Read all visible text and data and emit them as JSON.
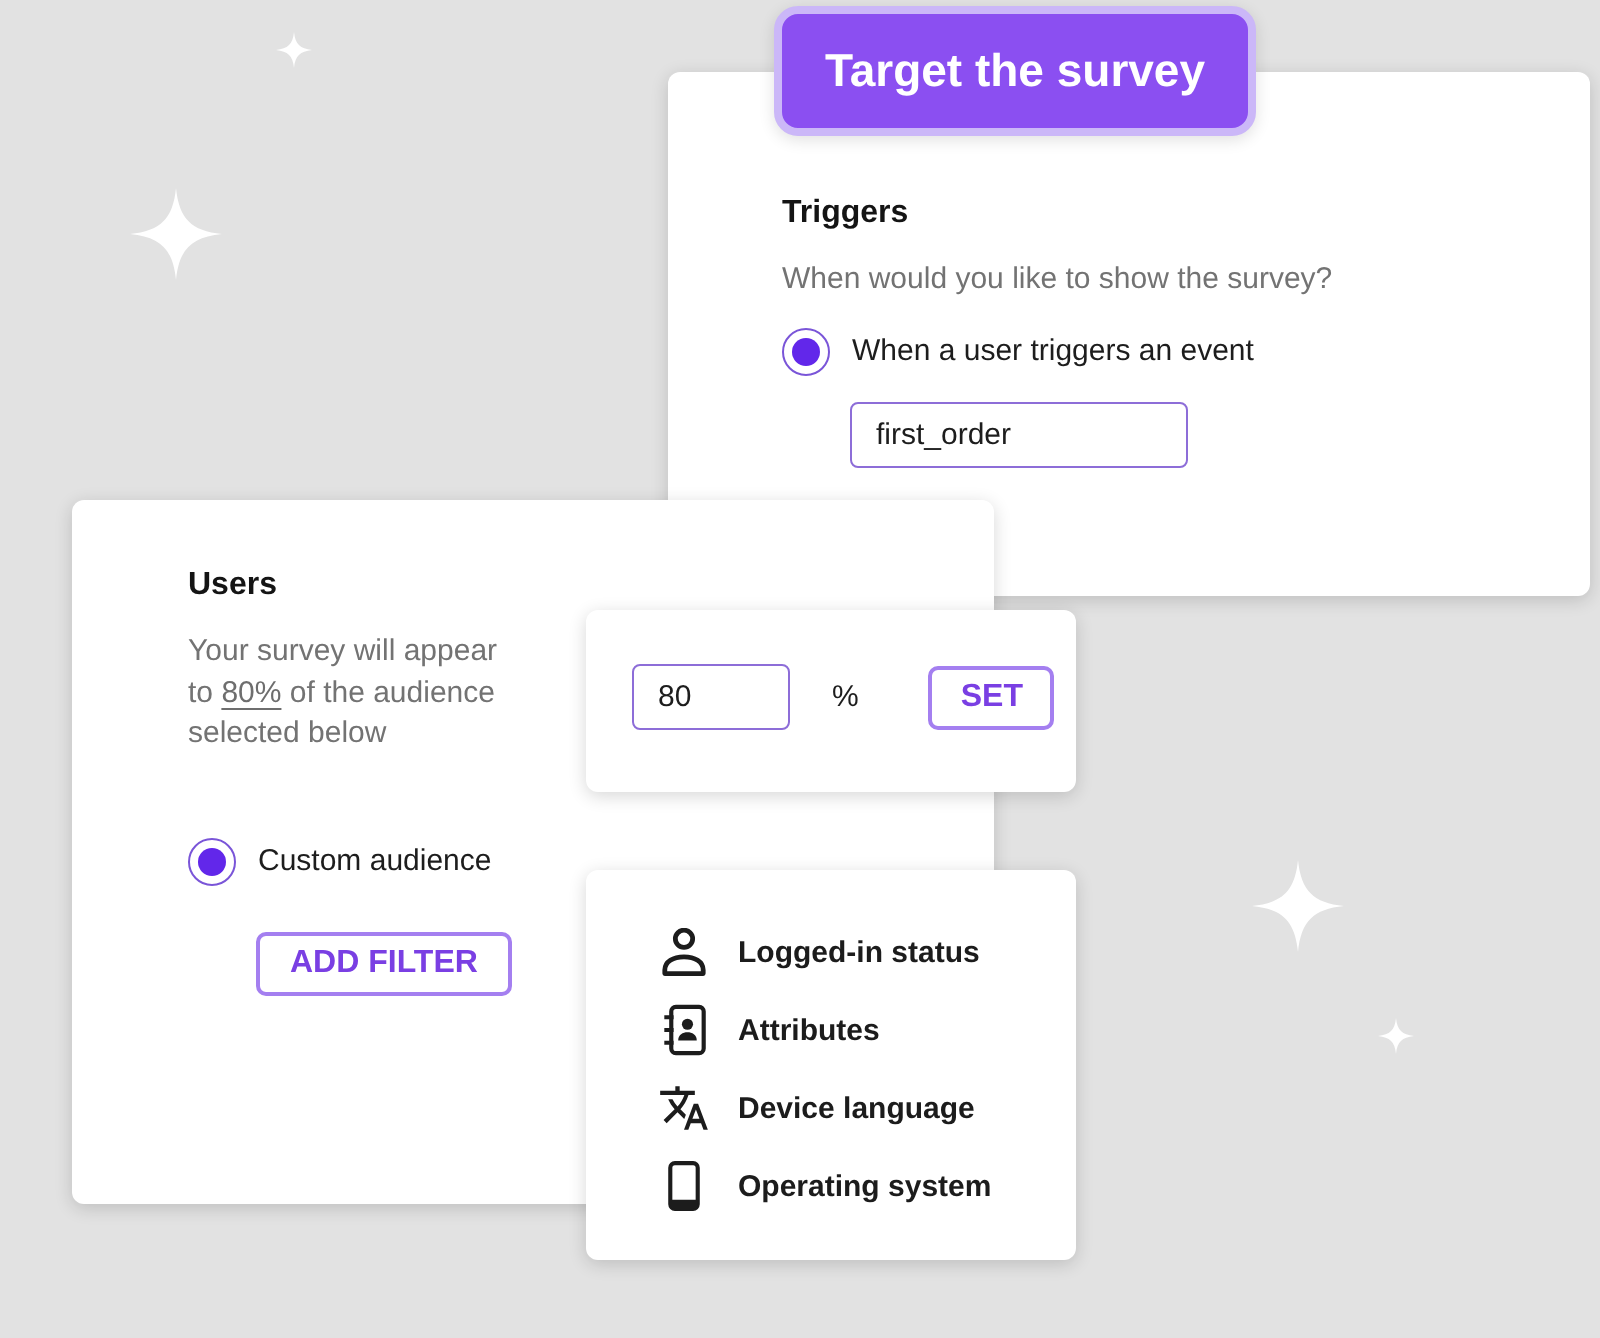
{
  "badge": {
    "label": "Target the survey"
  },
  "triggers_card": {
    "heading": "Triggers",
    "question": "When would you like to show the survey?",
    "option": {
      "label": "When a user triggers an event",
      "selected": true
    },
    "event_field": {
      "value": "first_order"
    }
  },
  "users_card": {
    "heading": "Users",
    "description": {
      "before": "Your survey will appear to",
      "link": "80%",
      "after": "of the audience selected below"
    },
    "option": {
      "label": "Custom audience",
      "selected": true
    },
    "add_filter_button": "ADD FILTER"
  },
  "percent_popup": {
    "field": {
      "value": "80"
    },
    "unit": "%",
    "set_button": "SET"
  },
  "filter_menu": {
    "items": [
      {
        "kind": "person",
        "label": "Logged-in status"
      },
      {
        "kind": "contacts",
        "label": "Attributes"
      },
      {
        "kind": "translate",
        "label": "Device language"
      },
      {
        "kind": "phone",
        "label": "Operating system"
      }
    ]
  }
}
